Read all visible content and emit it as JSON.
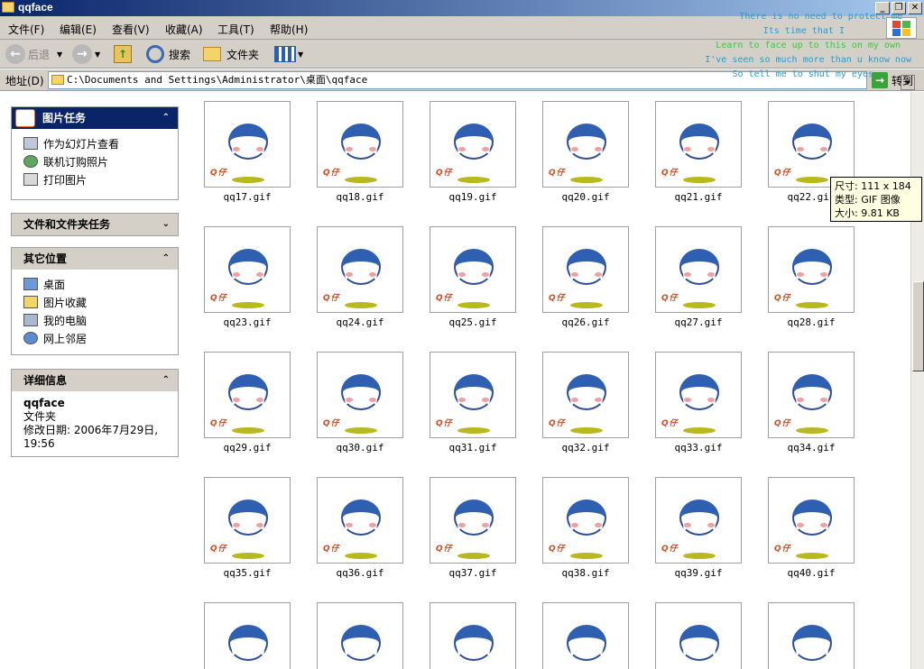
{
  "window": {
    "title": "qqface",
    "controls": {
      "minimize": "_",
      "maximize": "❐",
      "close": "✕"
    }
  },
  "menu": [
    "文件(F)",
    "编辑(E)",
    "查看(V)",
    "收藏(A)",
    "工具(T)",
    "帮助(H)"
  ],
  "toolbar": {
    "back": "后退",
    "search": "搜索",
    "folders": "文件夹"
  },
  "address": {
    "label": "地址(D)",
    "path": "C:\\Documents and Settings\\Administrator\\桌面\\qqface",
    "go": "转到"
  },
  "lyrics": [
    {
      "text": "There is no need to protect me",
      "color": "#2b9bd0"
    },
    {
      "text": "Its time that I",
      "color": "#2b9bd0"
    },
    {
      "text": "Learn to face up to this on my own",
      "color": "#3ac83a"
    },
    {
      "text": "I've seen so much more than u know now",
      "color": "#2b9bd0"
    },
    {
      "text": "So tell me to shut my eyes",
      "color": "#2b9bd0"
    }
  ],
  "sidebar": {
    "picture_tasks": {
      "title": "图片任务",
      "items": [
        "作为幻灯片查看",
        "联机订购照片",
        "打印图片"
      ]
    },
    "file_tasks": {
      "title": "文件和文件夹任务"
    },
    "other_places": {
      "title": "其它位置",
      "items": [
        "桌面",
        "图片收藏",
        "我的电脑",
        "网上邻居"
      ]
    },
    "details": {
      "title": "详细信息",
      "name": "qqface",
      "type": "文件夹",
      "modified": "修改日期: 2006年7月29日, 19:56"
    }
  },
  "files": {
    "row1": [
      "qq17.gif",
      "qq18.gif",
      "qq19.gif",
      "qq20.gif",
      "qq21.gif",
      "qq22.gif"
    ],
    "row2": [
      "qq23.gif",
      "qq24.gif",
      "qq25.gif",
      "qq26.gif",
      "qq27.gif",
      "qq28.gif"
    ],
    "row3": [
      "qq29.gif",
      "qq30.gif",
      "qq31.gif",
      "qq32.gif",
      "qq33.gif",
      "qq34.gif"
    ],
    "row4": [
      "qq35.gif",
      "qq36.gif",
      "qq37.gif",
      "qq38.gif",
      "qq39.gif",
      "qq40.gif"
    ]
  },
  "watermark": "Q仔",
  "tooltip": {
    "size": "尺寸: 111 x 184",
    "type": "类型: GIF 图像",
    "filesize": "大小: 9.81 KB"
  },
  "colors": {
    "titlebar": "#0a246a",
    "accent_face": "#2e5fb0",
    "panel_header": "#d4d0c8"
  }
}
